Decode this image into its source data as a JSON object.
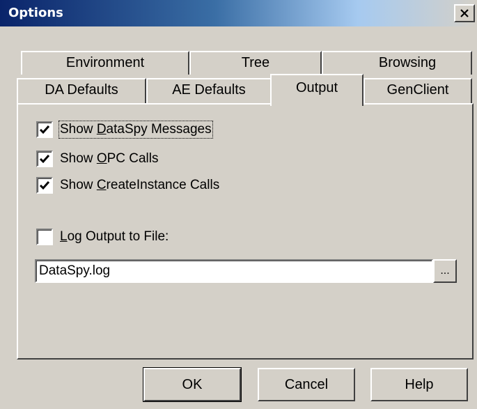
{
  "window": {
    "title": "Options",
    "close_glyph": "✕"
  },
  "tabs": {
    "row1": [
      "Environment",
      "Tree",
      "Browsing"
    ],
    "row2": [
      "DA Defaults",
      "AE Defaults",
      "Output",
      "GenClient"
    ],
    "active": "Output"
  },
  "output_panel": {
    "show_dataspy_messages": {
      "pre": "Show ",
      "key": "D",
      "post": "ataSpy Messages",
      "checked": true
    },
    "show_opc_calls": {
      "pre": "Show ",
      "key": "O",
      "post": "PC Calls",
      "checked": true
    },
    "show_createinstance_calls": {
      "pre": "Show ",
      "key": "C",
      "post": "reateInstance Calls",
      "checked": true
    },
    "log_output_to_file": {
      "pre": "",
      "key": "L",
      "post": "og Output to File:",
      "checked": false
    },
    "log_file": {
      "value": "DataSpy.log"
    },
    "browse_label": "..."
  },
  "buttons": {
    "ok": "OK",
    "cancel": "Cancel",
    "help": "Help"
  },
  "icons": {
    "checkmark": "check-icon",
    "close": "close-icon"
  }
}
